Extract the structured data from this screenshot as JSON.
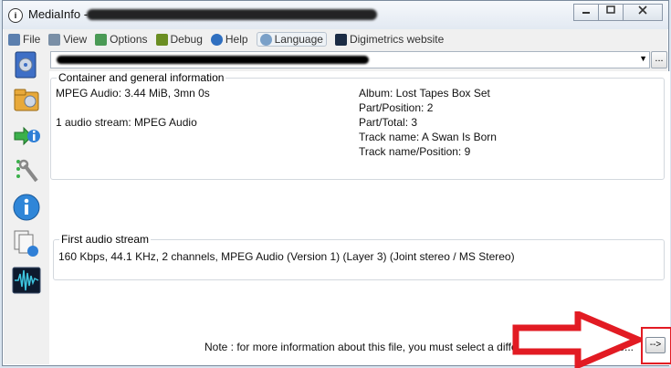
{
  "window": {
    "title": "MediaInfo -",
    "app_icon": "mediainfo-logo",
    "buttons": {
      "minimize": "▭",
      "maximize": "▢",
      "close": "✕"
    }
  },
  "menu": [
    {
      "label": "File",
      "icon": "file-menu-icon",
      "color": "#5b7fae"
    },
    {
      "label": "View",
      "icon": "view-menu-icon",
      "color": "#7a8fa6"
    },
    {
      "label": "Options",
      "icon": "options-menu-icon",
      "color": "#4a9a55"
    },
    {
      "label": "Debug",
      "icon": "debug-menu-icon",
      "color": "#6b8e23"
    },
    {
      "label": "Help",
      "icon": "help-menu-icon",
      "color": "#2f6fc0"
    },
    {
      "label": "Language",
      "icon": "language-menu-icon",
      "color": "#7aa0c8"
    },
    {
      "label": "Digimetrics website",
      "icon": "digimetrics-icon",
      "color": "#1b2c45"
    }
  ],
  "sidebar_icons": [
    "open-file-icon",
    "open-folder-icon",
    "export-icon",
    "preferences-icon",
    "about-icon",
    "multiple-files-icon",
    "waveform-icon"
  ],
  "file_combo": {
    "browse_label": "..."
  },
  "general": {
    "title": "Container and general information",
    "left": [
      "MPEG Audio: 3.44 MiB, 3mn 0s",
      "1 audio stream: MPEG Audio"
    ],
    "right": [
      "Album: Lost Tapes Box Set",
      "Part/Position: 2",
      "Part/Total: 3",
      "Track name: A Swan Is Born",
      "Track name/Position: 9"
    ]
  },
  "audio": {
    "title": "First audio stream",
    "line": "160 Kbps, 44.1 KHz, 2 channels, MPEG Audio (Version 1) (Layer 3) (Joint stereo / MS Stereo)"
  },
  "footer": {
    "note": "Note : for more information about this file, you must select a different view (Sheet, Tree...",
    "next_label": "-->"
  },
  "colors": {
    "highlight": "#e21b23"
  }
}
